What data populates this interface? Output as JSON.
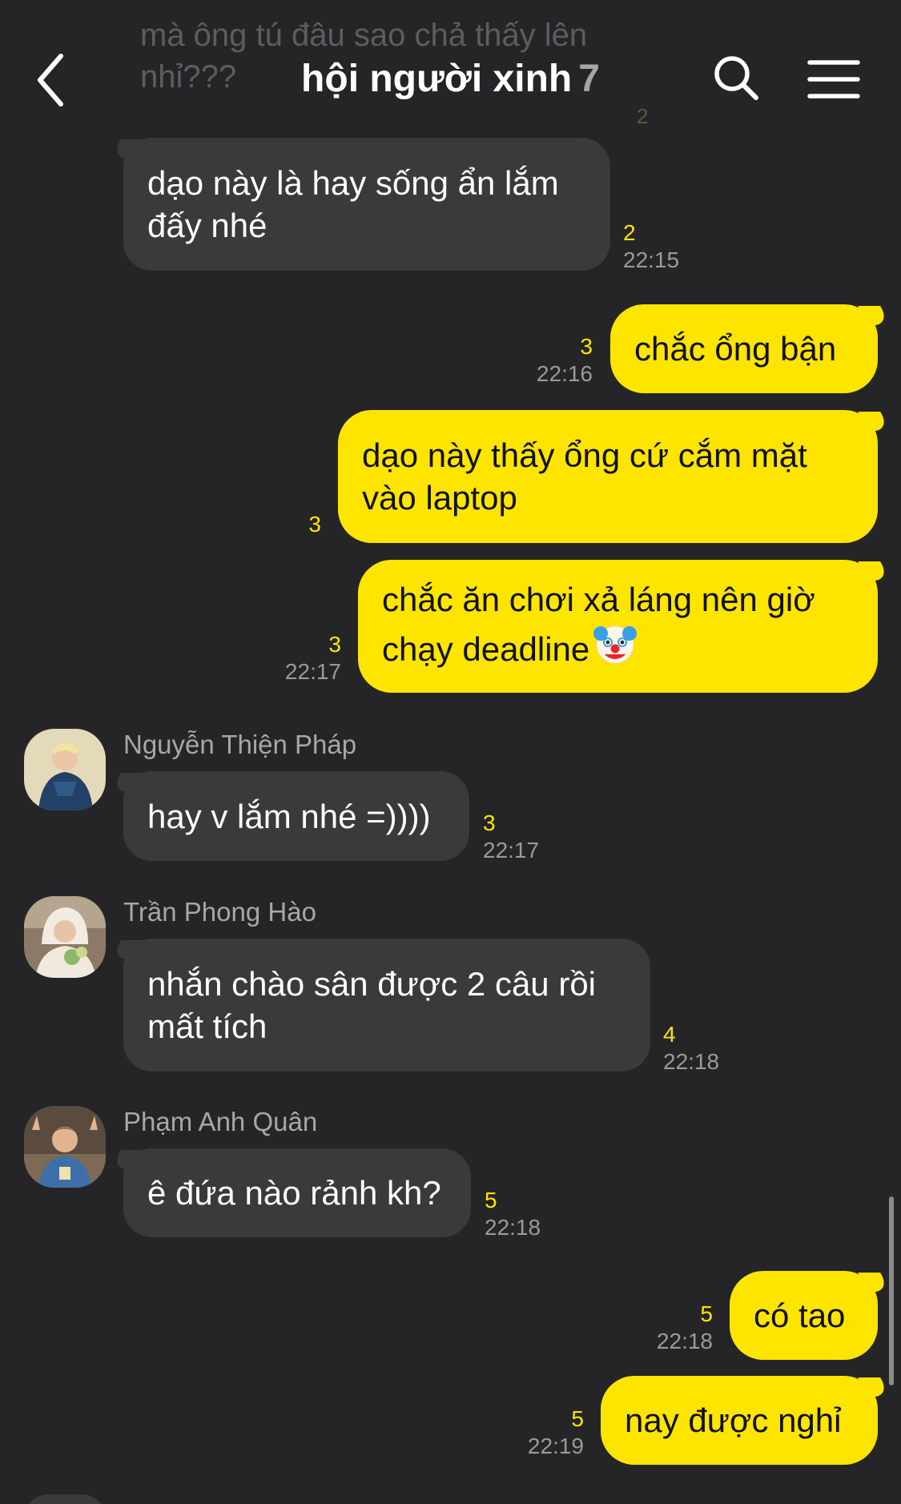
{
  "header": {
    "title": "hội người xinh",
    "member_count": "7"
  },
  "ghost_message": {
    "text": "mà ông tú đâu sao chả thấy lên nhỉ???",
    "unread": "2"
  },
  "messages": [
    {
      "text_lines": [
        "dạo này là hay sống ẩn lắm",
        "đấy nhé"
      ],
      "unread": "2",
      "time": "22:15"
    },
    {
      "text_lines": [
        "chắc ổng bận"
      ],
      "unread": "3",
      "time": "22:16"
    },
    {
      "text_lines": [
        "dạo này thấy ổng cứ cắm mặt",
        "vào laptop"
      ],
      "unread": "3"
    },
    {
      "text_lines": [
        "chắc ăn chơi xả láng nên giờ",
        "chạy deadline"
      ],
      "unread": "3",
      "time": "22:17"
    },
    {
      "sender": "Nguyễn Thiện Pháp",
      "text_lines": [
        "hay v lắm nhé =))))"
      ],
      "unread": "3",
      "time": "22:17"
    },
    {
      "sender": "Trần Phong Hào",
      "text_lines": [
        "nhắn chào sân được 2 câu rồi",
        "mất tích"
      ],
      "unread": "4",
      "time": "22:18"
    },
    {
      "sender": "Phạm Anh Quân",
      "text_lines": [
        "ê đứa nào rảnh kh?"
      ],
      "unread": "5",
      "time": "22:18"
    },
    {
      "text_lines": [
        "có tao"
      ],
      "unread": "5",
      "time": "22:18"
    },
    {
      "text_lines": [
        "nay được nghỉ"
      ],
      "unread": "5",
      "time": "22:19"
    }
  ],
  "icons": {
    "back": "chevron-left-icon",
    "search": "search-icon",
    "menu": "menu-icon",
    "emoji": "clown-face-emoji"
  },
  "colors": {
    "background": "#252528",
    "incoming_bubble": "#3a3a3d",
    "outgoing_bubble": "#fee500",
    "unread_count": "#fee500"
  }
}
